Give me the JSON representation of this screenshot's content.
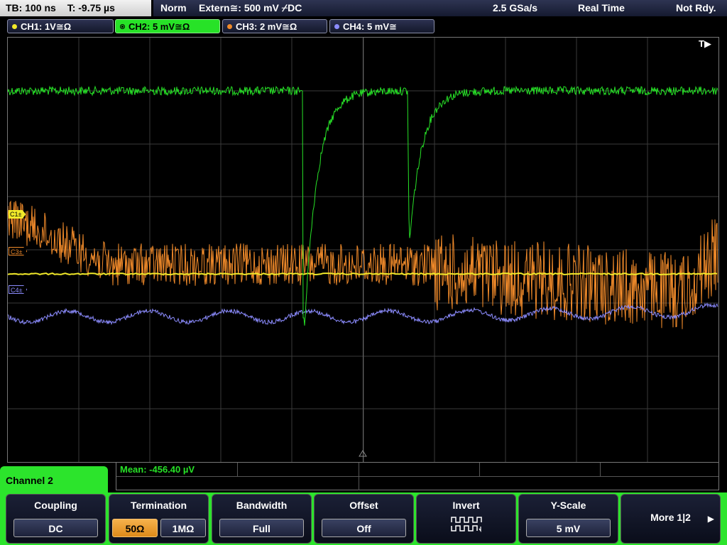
{
  "status": {
    "timebase": "TB: 100 ns",
    "trigger_time": "T: -9.75 µs",
    "trigger_mode": "Norm",
    "trigger_source": "Extern≅: 500 mV ⌿DC",
    "sample_rate": "2.5 GSa/s",
    "acq_mode": "Real Time",
    "state": "Not Rdy."
  },
  "channels": [
    {
      "label": "CH1: 1V≅Ω",
      "color": "#f2ea2a",
      "active": false
    },
    {
      "label": "CH2: 5 mV≅Ω",
      "color": "#27e227",
      "active": true
    },
    {
      "label": "CH3: 2 mV≅Ω",
      "color": "#f08a2a",
      "active": false
    },
    {
      "label": "CH4: 5 mV≅",
      "color": "#8c8cff",
      "active": false
    }
  ],
  "markers": {
    "trigger": "T▶",
    "ch1": "C1±",
    "ch3": "C3±",
    "ch4": "C4±"
  },
  "measurement": {
    "text": "Mean: -456.40 µV"
  },
  "menu": {
    "title": "Channel 2",
    "softkeys": {
      "coupling": {
        "label": "Coupling",
        "value": "DC"
      },
      "termination": {
        "label": "Termination",
        "opt1": "50Ω",
        "opt2": "1MΩ"
      },
      "bandwidth": {
        "label": "Bandwidth",
        "value": "Full"
      },
      "offset": {
        "label": "Offset",
        "value": "Off"
      },
      "invert": {
        "label": "Invert",
        "icon": "invert-waveform-icon"
      },
      "yscale": {
        "label": "Y-Scale",
        "value": "5 mV"
      },
      "more": {
        "label": "More 1|2",
        "icon": "right-arrow-icon"
      }
    }
  },
  "colors": {
    "ch1": "#f2ea2a",
    "ch2": "#27e227",
    "ch3": "#f08a2a",
    "ch4": "#8c8cff",
    "menu_accent": "#2ce42c",
    "selected": "#f0a030"
  }
}
